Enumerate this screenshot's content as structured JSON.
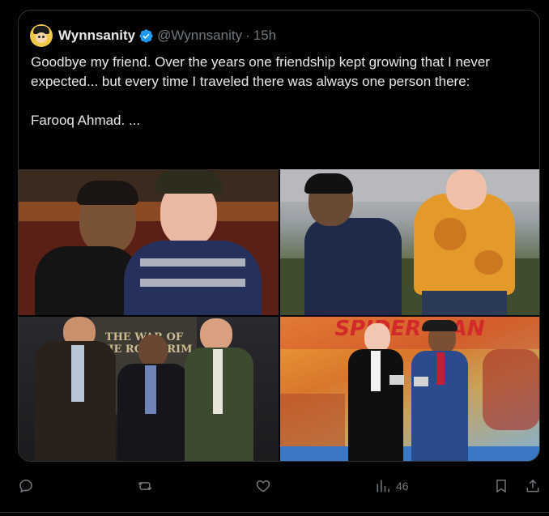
{
  "quoted_tweet": {
    "display_name": "Wynnsanity",
    "handle": "@Wynnsanity",
    "separator": "·",
    "time": "15h",
    "text": "Goodbye my friend. Over the years one friendship kept growing that I never expected... but every time I traveled there was always one person there:\n\nFarooq Ahmad. ...",
    "verified_color": "#1d9bf0",
    "photos": [
      {
        "icon": "photo-restaurant-selfie"
      },
      {
        "icon": "photo-outdoor-event"
      },
      {
        "icon": "photo-movie-premiere-rohirrim",
        "poster_text": "THE WAR OF THE ROHIRRIM"
      },
      {
        "icon": "photo-movie-premiere-spiderman",
        "poster_text": "SPIDER-MAN"
      }
    ]
  },
  "actions": {
    "reply_icon": "reply-icon",
    "retweet_icon": "retweet-icon",
    "like_icon": "heart-icon",
    "views_icon": "views-icon",
    "views_count": "46",
    "bookmark_icon": "bookmark-icon",
    "share_icon": "share-icon"
  },
  "colors": {
    "background": "#000000",
    "text": "#e7e9ea",
    "secondary": "#71767b",
    "border": "#2f3336"
  }
}
